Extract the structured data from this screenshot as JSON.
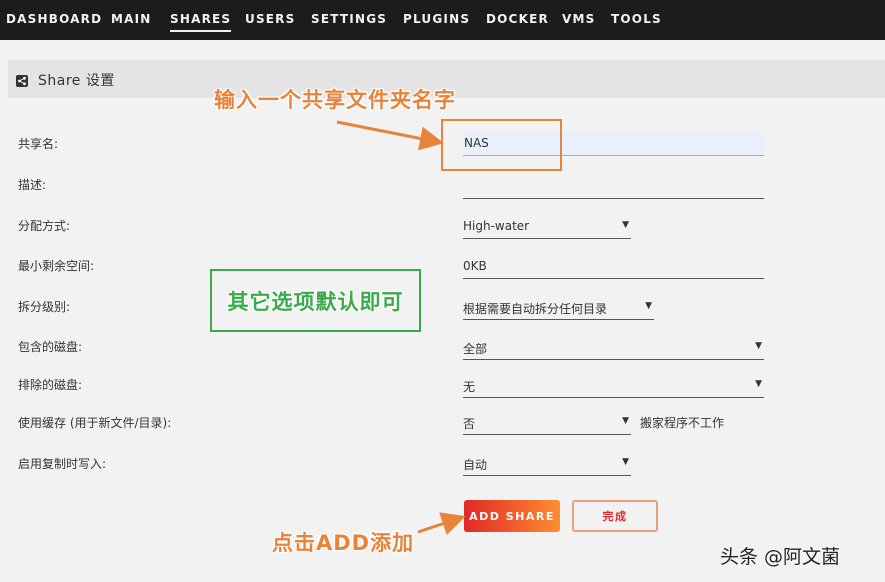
{
  "nav": {
    "items": [
      "DASHBOARD",
      "MAIN",
      "SHARES",
      "USERS",
      "SETTINGS",
      "PLUGINS",
      "DOCKER",
      "VMS",
      "TOOLS"
    ],
    "active": "SHARES"
  },
  "section": {
    "title": "Share 设置",
    "icon": "share-icon"
  },
  "form": {
    "share_name": {
      "label": "共享名:",
      "value": "NAS"
    },
    "comment": {
      "label": "描述:",
      "value": ""
    },
    "allocation": {
      "label": "分配方式:",
      "value": "High-water"
    },
    "min_free": {
      "label": "最小剩余空间:",
      "value": "0KB"
    },
    "split_level": {
      "label": "拆分级别:",
      "value": "根据需要自动拆分任何目录"
    },
    "included_disks": {
      "label": "包含的磁盘:",
      "value": "全部"
    },
    "excluded_disks": {
      "label": "排除的磁盘:",
      "value": "无"
    },
    "use_cache": {
      "label": "使用缓存 (用于新文件/目录):",
      "value": "否",
      "note": "搬家程序不工作"
    },
    "copy_on_write": {
      "label": "启用复制时写入:",
      "value": "自动"
    }
  },
  "buttons": {
    "add_share": "ADD SHARE",
    "done": "完成"
  },
  "annotations": {
    "input_name": "输入一个共享文件夹名字",
    "defaults": "其它选项默认即可",
    "click_add": "点击ADD添加"
  },
  "watermark": "头条 @阿文菌",
  "colors": {
    "accent_orange": "#e8833a",
    "accent_green": "#3aaa4a",
    "button_red": "#e22828"
  }
}
